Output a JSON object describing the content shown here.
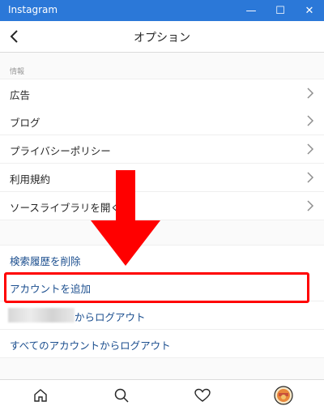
{
  "window": {
    "title": "Instagram",
    "controls": {
      "minimize": "—",
      "maximize": "☐",
      "close": "✕"
    }
  },
  "navbar": {
    "title": "オプション",
    "back_icon": "chevron-left-icon"
  },
  "sections": {
    "info_header": "情報",
    "info_items": [
      {
        "label": "広告"
      },
      {
        "label": "ブログ"
      },
      {
        "label": "プライバシーポリシー"
      },
      {
        "label": "利用規約"
      },
      {
        "label": "ソースライブラリを開く"
      }
    ],
    "account_items": [
      {
        "label": "検索履歴を削除"
      },
      {
        "label": "アカウントを追加"
      },
      {
        "label": "からログアウト"
      },
      {
        "label": "すべてのアカウントからログアウト"
      }
    ]
  },
  "annotations": {
    "arrow_color": "#ff0000",
    "highlight_color": "#ff0000"
  },
  "tabbar": {
    "icons": [
      "home-icon",
      "search-icon",
      "heart-icon",
      "profile-avatar"
    ]
  },
  "colors": {
    "titlebar": "#2b78d8",
    "link_blue": "#1c4f8f"
  }
}
